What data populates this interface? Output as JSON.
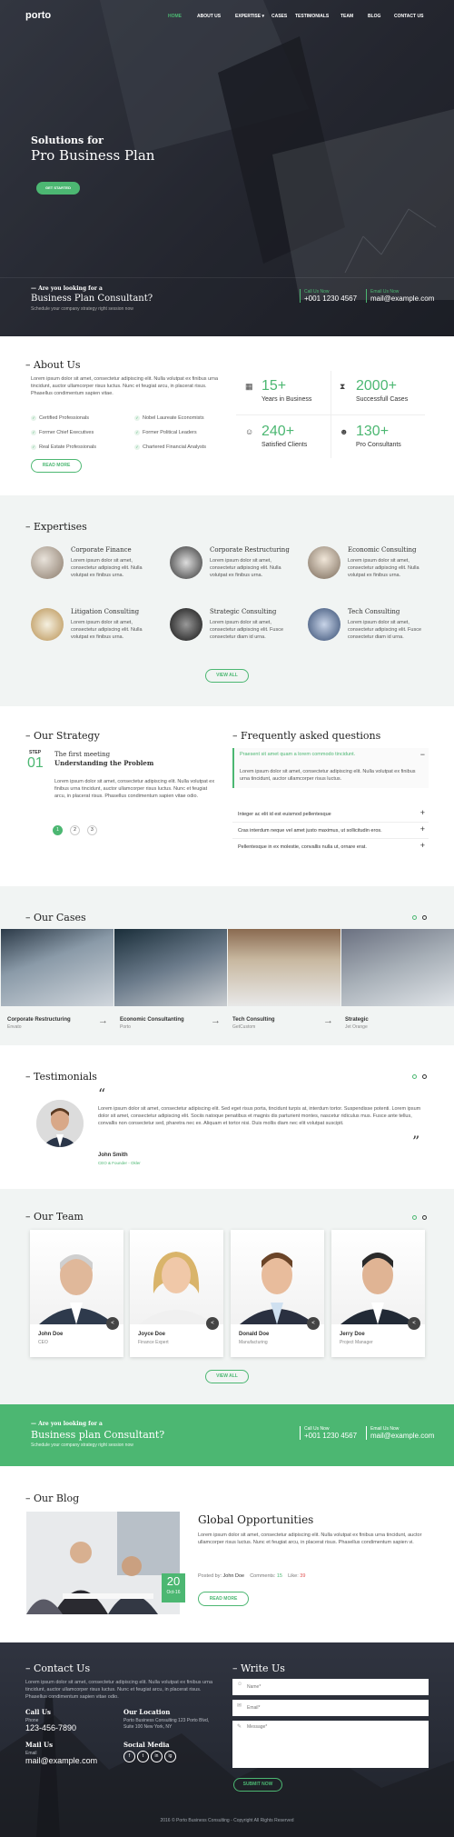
{
  "nav": {
    "logo": "porto",
    "items": [
      "HOME",
      "ABOUT US",
      "EXPERTISE",
      "CASES",
      "TESTIMONIALS",
      "TEAM",
      "BLOG",
      "CONTACT US"
    ]
  },
  "hero": {
    "line1": "Solutions for",
    "line2": "Pro Business Plan",
    "button": "GET STARTED",
    "cta_small": "Are you looking for a",
    "cta_big": "Business Plan Consultant?",
    "cta_sub": "Schedule your company strategy right session now",
    "call_label": "Call Us Now",
    "call_value": "+001 1230 4567",
    "email_label": "Email Us Now",
    "email_value": "mail@example.com"
  },
  "about": {
    "title": "About Us",
    "text": "Lorem ipsum dolor sit amet, consectetur adipiscing elit. Nulla volutpat ex finibus urna tincidunt, auctor ullamcorper risus luctus. Nunc et feugiat arcu, in placerat risus. Phasellus condimentum sapien vitae.",
    "list_left": [
      "Certified Professionals",
      "Former Chief Executives",
      "Real Estate Professionals"
    ],
    "list_right": [
      "Nobel Laureate Economists",
      "Former Political Leaders",
      "Chartered Financial Analysts"
    ],
    "button": "READ MORE",
    "stats": [
      {
        "value": "15+",
        "label": "Years in Business"
      },
      {
        "value": "2000+",
        "label": "Successfull Cases"
      },
      {
        "value": "240+",
        "label": "Satisfied Clients"
      },
      {
        "value": "130+",
        "label": "Pro Consultants"
      }
    ]
  },
  "expertises": {
    "title": "Expertises",
    "items": [
      {
        "name": "Corporate Finance",
        "text": "Lorem ipsum dolor sit amet, consectetur adipiscing elit. Nulla volutpat ex finibus urna."
      },
      {
        "name": "Corporate Restructuring",
        "text": "Lorem ipsum dolor sit amet, consectetur adipiscing elit. Nulla volutpat ex finibus urna."
      },
      {
        "name": "Economic Consulting",
        "text": "Lorem ipsum dolor sit amet, consectetur adipiscing elit. Nulla volutpat ex finibus urna."
      },
      {
        "name": "Litigation Consulting",
        "text": "Lorem ipsum dolor sit amet, consectetur adipiscing elit. Nulla volutpat ex finibus urna."
      },
      {
        "name": "Strategic Consulting",
        "text": "Lorem ipsum dolor sit amet, consectetur adipiscing elit. Fusce consectetur diam id urna."
      },
      {
        "name": "Tech Consulting",
        "text": "Lorem ipsum dolor sit amet, consectetur adipiscing elit. Fusce consectetur diam id urna."
      }
    ],
    "button": "VIEW ALL"
  },
  "strategy": {
    "title": "Our Strategy",
    "step_label": "STEP",
    "step_num": "01",
    "step_title1": "The first meeting",
    "step_title2": "Understanding the Problem",
    "text": "Lorem ipsum dolor sit amet, consectetur adipiscing elit. Nulla volutpat ex finibus urna tincidunt, auctor ullamcorper risus luctus. Nunc et feugiat arcu, in placerat risus. Phasellus condimentum sapien vitae odio.",
    "pages": [
      "1",
      "2",
      "3"
    ]
  },
  "faq": {
    "title": "Frequently asked questions",
    "open_q": "Praesent sit amet quam a lorem commodo tincidunt.",
    "open_a": "Lorem ipsum dolor sit amet, consectetur adipiscing elit. Nulla volutpat ex finibus urna tincidunt, auctor ullamcorper risus luctus.",
    "questions": [
      "Integer ac elit id est euismod pellentesque",
      "Cras interdum neque vel amet justo maximus, ut sollicitudin eros.",
      "Pellentesque in ex molestie, convallis nulla ut, ornare erat."
    ]
  },
  "cases": {
    "title": "Our Cases",
    "items": [
      {
        "name": "Corporate Restructuring",
        "client": "Envato"
      },
      {
        "name": "Economic Consultanting",
        "client": "Porto"
      },
      {
        "name": "Tech Consulting",
        "client": "GetCustom"
      },
      {
        "name": "Strategic",
        "client": "Jet Orange"
      }
    ]
  },
  "testimonials": {
    "title": "Testimonials",
    "quote": "Lorem ipsum dolor sit amet, consectetur adipiscing elit. Sed eget risus porta, tincidunt turpis at, interdum tortor. Suspendisse potenti. Lorem ipsum dolor sit amet, consectetur adipiscing elit. Sociis natoque penatibus et magnis dis parturient montes, nascetur ridiculus mus. Fusce ante tellus, convallis non consectetur sed, pharetra nec ex. Aliquam et tortor nisi. Duis mollis diam nec elit volutpat suscipit.",
    "name": "John Smith",
    "role": "CEO & Founder - Okler"
  },
  "team": {
    "title": "Our Team",
    "members": [
      {
        "name": "John Doe",
        "role": "CEO"
      },
      {
        "name": "Joyce Doe",
        "role": "Finance Expert"
      },
      {
        "name": "Donald Doe",
        "role": "Manufacturing"
      },
      {
        "name": "Jerry Doe",
        "role": "Project Manager"
      }
    ],
    "button": "VIEW ALL"
  },
  "cta": {
    "small": "Are you looking for a",
    "big": "Business plan Consultant?",
    "sub": "Schedule your company strategy right session now",
    "call_label": "Call Us Now",
    "call_value": "+001 1230 4567",
    "email_label": "Email Us Now",
    "email_value": "mail@example.com"
  },
  "blog": {
    "title": "Our Blog",
    "post_title": "Global Opportunities",
    "text": "Lorem ipsum dolor sit amet, consectetur adipiscing elit. Nulla volutpat ex finibus urna tincidunt, auctor ullamcorper risus luctus. Nunc et feugiat arcu, in placerat risus. Phasellus condimentum sapien vi.",
    "posted_label": "Posted by:",
    "author": "John Doe",
    "comments_label": "Comments:",
    "comments": "15",
    "like_label": "Like:",
    "likes": "39",
    "day": "20",
    "month": "Oct-16",
    "button": "READ MORE"
  },
  "contact": {
    "title": "Contact Us",
    "text": "Lorem ipsum dolor sit amet, consectetur adipiscing elit. Nulla volutpat ex finibus urna tincidunt, auctor ullamcorper risus luctus. Nunc et feugiat arcu, in placerat risus. Phasellus condimentum sapien vitae odio.",
    "call_title": "Call Us",
    "phone_label": "Phone",
    "phone": "123-456-7890",
    "mail_title": "Mail Us",
    "email_label": "Email",
    "email": "mail@example.com",
    "location_title": "Our Location",
    "location": "Porto Business Consulting 123 Porto Blvd, Suite 100 New York, NY",
    "social_title": "Social Media",
    "social": [
      "f",
      "t",
      "in",
      "ig"
    ]
  },
  "write": {
    "title": "Write Us",
    "name_ph": "Name*",
    "email_ph": "Email*",
    "msg_ph": "Message*",
    "button": "SUBMIT NOW"
  },
  "footer": {
    "text": "2016 © Porto Business Consulting - Copyright All Rights Reserved"
  },
  "colors": {
    "accent": "#4cb772",
    "dark": "#2b2f38"
  }
}
